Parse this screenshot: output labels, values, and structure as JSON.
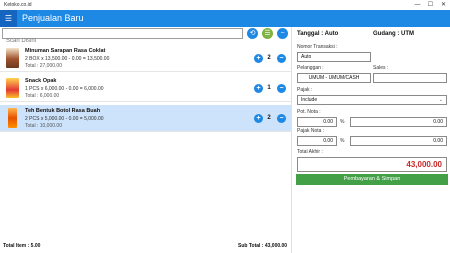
{
  "window": {
    "title": "Ketoko.co.id",
    "controls": [
      "—",
      "☐",
      "✕"
    ]
  },
  "header": {
    "menu_icon": "☰",
    "title": "Penjualan Baru"
  },
  "search": {
    "placeholder": "Scan Disini",
    "value": ""
  },
  "toolbar": {
    "buttons": [
      {
        "icon": "sync-icon",
        "glyph": "⟲",
        "color": "#1e88e5"
      },
      {
        "icon": "list-icon",
        "glyph": "☰",
        "color": "#7cb342"
      },
      {
        "icon": "remove-icon",
        "glyph": "−",
        "color": "#1e88e5"
      }
    ]
  },
  "items": [
    {
      "name": "Minuman Sarapan Rasa Coklat",
      "detail": "2 BOX x 13,500.00 - 0.00 = 13,500.00",
      "total": "Total : 27,000.00",
      "qty": "2",
      "selected": false
    },
    {
      "name": "Snack Opak",
      "detail": "1 PCS x 6,000.00 - 0.00 = 6,000.00",
      "total": "Total : 6,000.00",
      "qty": "1",
      "selected": false
    },
    {
      "name": "Teh Bentuk Botol Rasa Buah",
      "detail": "2 PCS x 5,000.00 - 0.00 = 5,000.00",
      "total": "Total : 10,000.00",
      "qty": "2",
      "selected": true
    }
  ],
  "footer": {
    "total_item": "Total Item : 5.00",
    "sub_total": "Sub Total : 43,000.00"
  },
  "side": {
    "tanggal": "Tanggal : Auto",
    "gudang": "Gudang : UTM",
    "nomor_label": "Nomor Transaksi :",
    "nomor_value": "Auto",
    "pelanggan_label": "Pelanggan :",
    "pelanggan_value": "UMUM - UMUM/CASH",
    "sales_label": "Sales :",
    "sales_value": "",
    "pajak_label": "Pajak :",
    "pajak_value": "Include",
    "pot_label": "Pot. Nota :",
    "pot_pct": "0.00",
    "pot_amount": "0.00",
    "pajak_nota_label": "Pajak Nota :",
    "pajak_nota_pct": "0.00",
    "pajak_nota_amount": "0.00",
    "percent_sign": "%",
    "total_label": "Total Akhir :",
    "total_value": "43,000.00",
    "pay_button": "Pembayaran & Simpan"
  },
  "colors": {
    "accent": "#1e88e5",
    "pay": "#43a047",
    "total": "#c62828",
    "selected_row": "#cde3fb"
  }
}
